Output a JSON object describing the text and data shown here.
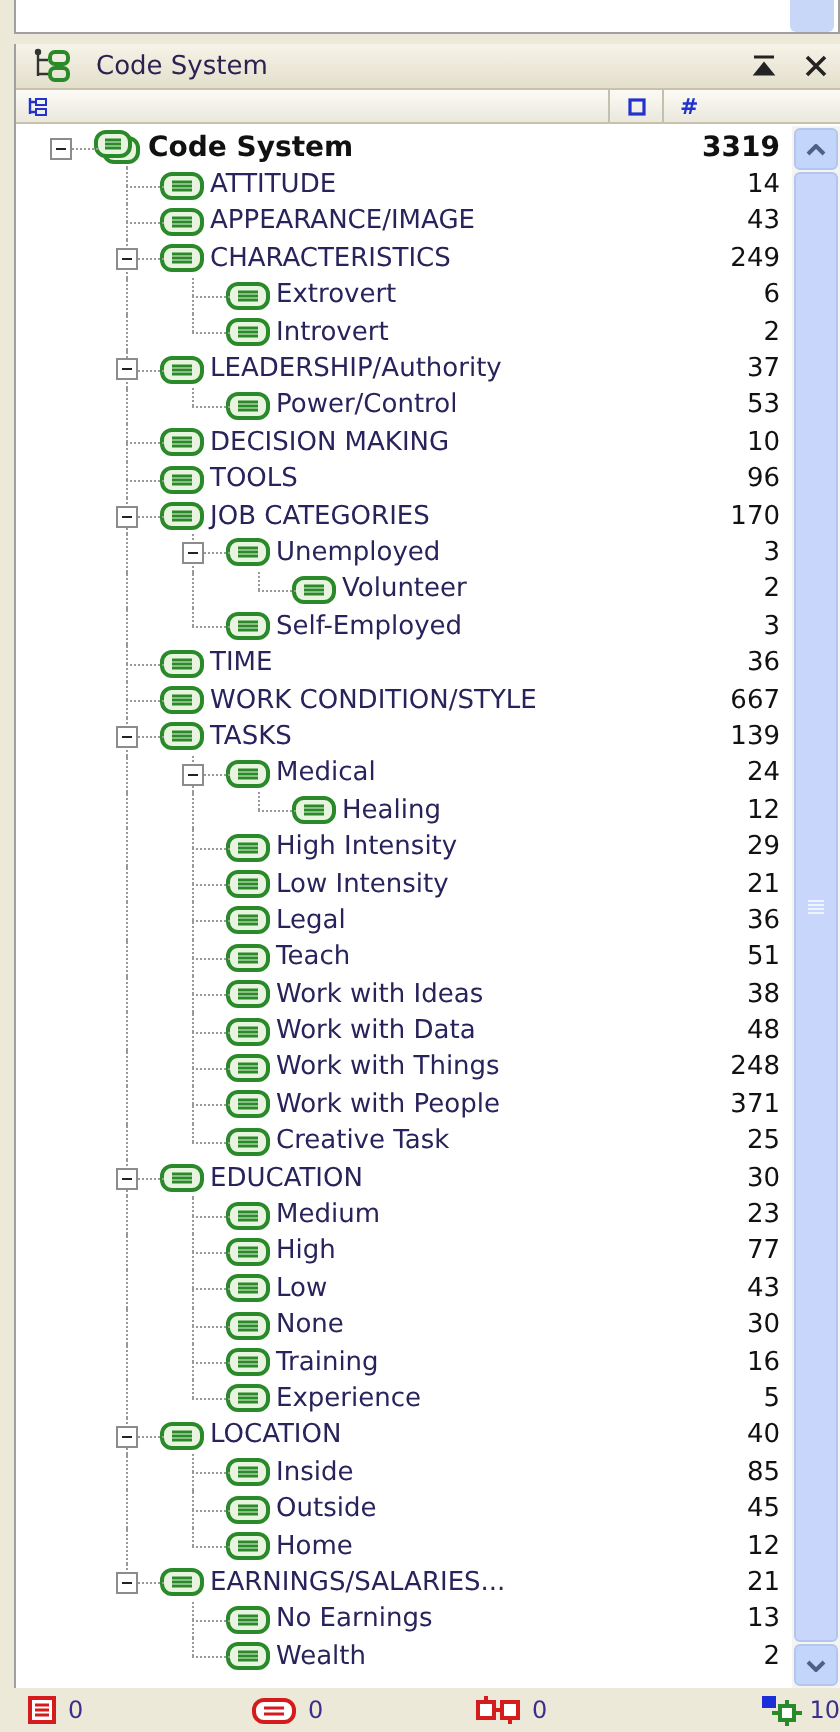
{
  "panel": {
    "title": "Code System"
  },
  "columns": [
    {
      "kind": "tree"
    },
    {
      "kind": "square"
    },
    {
      "kind": "text",
      "label": "#"
    }
  ],
  "tree": [
    {
      "label": "Code System",
      "count": "3319",
      "expanded": true,
      "children": [
        {
          "label": "ATTITUDE",
          "count": "14"
        },
        {
          "label": "APPEARANCE/IMAGE",
          "count": "43"
        },
        {
          "label": "CHARACTERISTICS",
          "count": "249",
          "expanded": true,
          "children": [
            {
              "label": "Extrovert",
              "count": "6"
            },
            {
              "label": "Introvert",
              "count": "2"
            }
          ]
        },
        {
          "label": "LEADERSHIP/Authority",
          "count": "37",
          "expanded": true,
          "children": [
            {
              "label": "Power/Control",
              "count": "53"
            }
          ]
        },
        {
          "label": "DECISION MAKING",
          "count": "10"
        },
        {
          "label": "TOOLS",
          "count": "96"
        },
        {
          "label": "JOB CATEGORIES",
          "count": "170",
          "expanded": true,
          "children": [
            {
              "label": "Unemployed",
              "count": "3",
              "expanded": true,
              "children": [
                {
                  "label": "Volunteer",
                  "count": "2"
                }
              ]
            },
            {
              "label": "Self-Employed",
              "count": "3"
            }
          ]
        },
        {
          "label": "TIME",
          "count": "36"
        },
        {
          "label": "WORK CONDITION/STYLE",
          "count": "667"
        },
        {
          "label": "TASKS",
          "count": "139",
          "expanded": true,
          "children": [
            {
              "label": "Medical",
              "count": "24",
              "expanded": true,
              "children": [
                {
                  "label": "Healing",
                  "count": "12"
                }
              ]
            },
            {
              "label": "High Intensity",
              "count": "29"
            },
            {
              "label": "Low Intensity",
              "count": "21"
            },
            {
              "label": "Legal",
              "count": "36"
            },
            {
              "label": "Teach",
              "count": "51"
            },
            {
              "label": "Work with Ideas",
              "count": "38"
            },
            {
              "label": "Work with Data",
              "count": "48"
            },
            {
              "label": "Work with Things",
              "count": "248"
            },
            {
              "label": "Work with People",
              "count": "371"
            },
            {
              "label": "Creative Task",
              "count": "25"
            }
          ]
        },
        {
          "label": "EDUCATION",
          "count": "30",
          "expanded": true,
          "children": [
            {
              "label": "Medium",
              "count": "23"
            },
            {
              "label": "High",
              "count": "77"
            },
            {
              "label": "Low",
              "count": "43"
            },
            {
              "label": "None",
              "count": "30"
            },
            {
              "label": "Training",
              "count": "16"
            },
            {
              "label": "Experience",
              "count": "5"
            }
          ]
        },
        {
          "label": "LOCATION",
          "count": "40",
          "expanded": true,
          "children": [
            {
              "label": "Inside",
              "count": "85"
            },
            {
              "label": "Outside",
              "count": "45"
            },
            {
              "label": "Home",
              "count": "12"
            }
          ]
        },
        {
          "label": "EARNINGS/SALARIES...",
          "count": "21",
          "expanded": true,
          "children": [
            {
              "label": "No Earnings",
              "count": "13"
            },
            {
              "label": "Wealth",
              "count": "2"
            }
          ]
        }
      ]
    }
  ],
  "status_bar": [
    {
      "kind": "memo",
      "count": "0"
    },
    {
      "kind": "code",
      "count": "0"
    },
    {
      "kind": "link",
      "count": "0"
    },
    {
      "kind": "map",
      "count": "10"
    }
  ]
}
